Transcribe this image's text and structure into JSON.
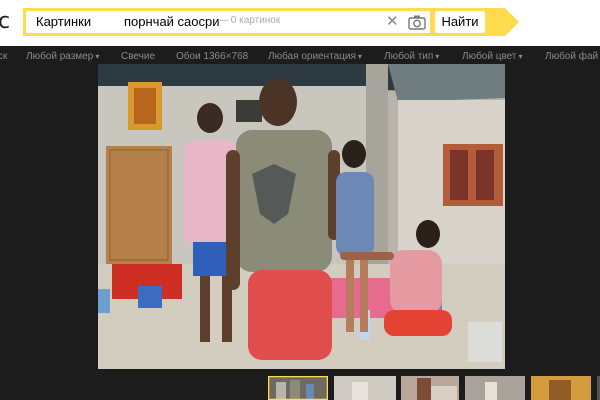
{
  "search": {
    "logo_fragment": "с",
    "service_chip": "Картинки",
    "query": "порнчай саоcри",
    "result_count": "— 0 картинок",
    "submit_label": "Найти"
  },
  "filters": [
    {
      "label": "ск",
      "dropdown": false
    },
    {
      "label": "Любой размер",
      "dropdown": true
    },
    {
      "label": "Свечие",
      "dropdown": false
    },
    {
      "label": "Обои 1366×768",
      "dropdown": false
    },
    {
      "label": "Любая ориентация",
      "dropdown": true
    },
    {
      "label": "Любой тип",
      "dropdown": true
    },
    {
      "label": "Любой цвет",
      "dropdown": true
    },
    {
      "label": "Любой фай",
      "dropdown": false
    }
  ],
  "colors": {
    "accent_yellow": "#ffdb4d",
    "page_background": "#1c1c1c",
    "filter_text": "#8a8a8a",
    "thumb_selected": "#ffdb4d"
  },
  "thumbnails": [
    {
      "name": "thumb-1",
      "selected": true
    },
    {
      "name": "thumb-2",
      "selected": false
    },
    {
      "name": "thumb-3",
      "selected": false
    },
    {
      "name": "thumb-4",
      "selected": false
    },
    {
      "name": "thumb-5",
      "selected": false
    },
    {
      "name": "thumb-6",
      "selected": false
    }
  ]
}
